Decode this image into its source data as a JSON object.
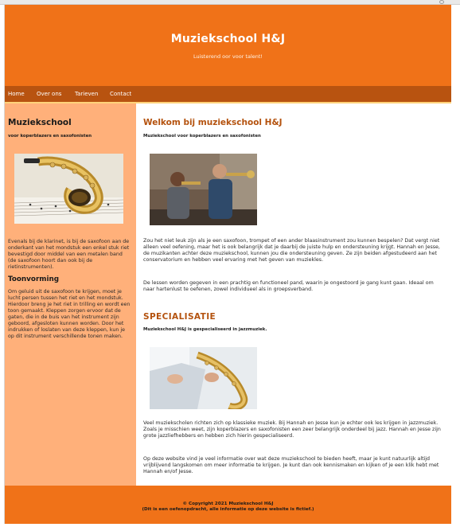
{
  "header": {
    "title": "Muziekschool H&J",
    "tagline": "Luisterend oor voor talent!"
  },
  "nav": {
    "items": [
      {
        "label": "Home"
      },
      {
        "label": "Over ons"
      },
      {
        "label": "Tarieven"
      },
      {
        "label": "Contact"
      }
    ]
  },
  "sidebar": {
    "title": "Muziekschool",
    "subtitle": "voor koperblazers en saxofonisten",
    "image_icon": "saxophone-photo",
    "paragraph1": "Evenals bij de klarinet, is bij de saxofoon aan de onderkant van het mondstuk een enkel stuk riet bevestigd door middel van een metalen band (de saxofoon hoort dan ook bij de rietinstrumenten).",
    "heading": "Toonvorming",
    "paragraph2": "Om geluid uit de saxofoon te krijgen, moet je lucht persen tussen het riet en het mondstuk. Hierdoor breng je het riet in trilling en wordt een toon gemaakt. Kleppen zorgen ervoor dat de gaten, die in de buis van het instrument zijn geboord, afgesloten kunnen worden. Door het indrukken of loslaten van deze kleppen, kun je op dit instrument verschillende tonen maken."
  },
  "main": {
    "heading": "Welkom bij muziekschool H&J",
    "subtitle": "Muziekschool voor koperblazers en saxofonisten",
    "image1_icon": "trumpet-players-photo",
    "paragraph1": "Zou het niet leuk zijn als je een saxofoon, trompet of een ander blaasinstrument zou kunnen bespelen? Dat vergt niet alleen veel oefening, maar het is ook belangrijk dat je daarbij de juiste hulp en ondersteuning krijgt. Hannah en Jesse, de muzikanten achter deze muziekschool, kunnen jou die ondersteuning geven. Ze zijn beiden afgestudeerd aan het conservatorium en hebben veel ervaring met het geven van muziekles.",
    "paragraph2": "De lessen worden gegeven in een prachtig en functioneel pand, waarin je ongestoord je gang kunt gaan. Ideaal om naar hartenlust te oefenen, zowel individueel als in groepsverband.",
    "heading2": "SPECIALISATIE",
    "subtitle2": "Muziekschool H&J is gespecialiseerd in jazzmuziek.",
    "image2_icon": "saxophone-player-photo",
    "paragraph3": "Veel muziekscholen richten zich op klassieke muziek. Bij Hannah en Jesse kun je echter ook les krijgen in jazzmuziek. Zoals je misschien weet, zijn koperblazers en saxofonisten een zeer belangrijk onderdeel bij jazz. Hannah en Jesse zijn grote jazzliefhebbers en hebben zich hierin gespecialiseerd.",
    "paragraph4": "Op deze website vind je veel informatie over wat deze muziekschool te bieden heeft, maar je kunt natuurlijk altijd vrijblijvend langskomen om meer informatie te krijgen. Je kunt dan ook kennismaken en kijken of je een klik hebt met Hannah en/of Jesse."
  },
  "footer": {
    "copyright": "© Copyright 2021 Muziekschool H&J",
    "note": "(Dit is een oefenopdracht, alle informatie op deze website is fictief.)"
  },
  "colors": {
    "header_bg": "#f07218",
    "nav_bg": "#b85310",
    "nav_border": "#ffd27a",
    "sidebar_bg": "#ffb07a",
    "heading_color": "#b4520e"
  }
}
